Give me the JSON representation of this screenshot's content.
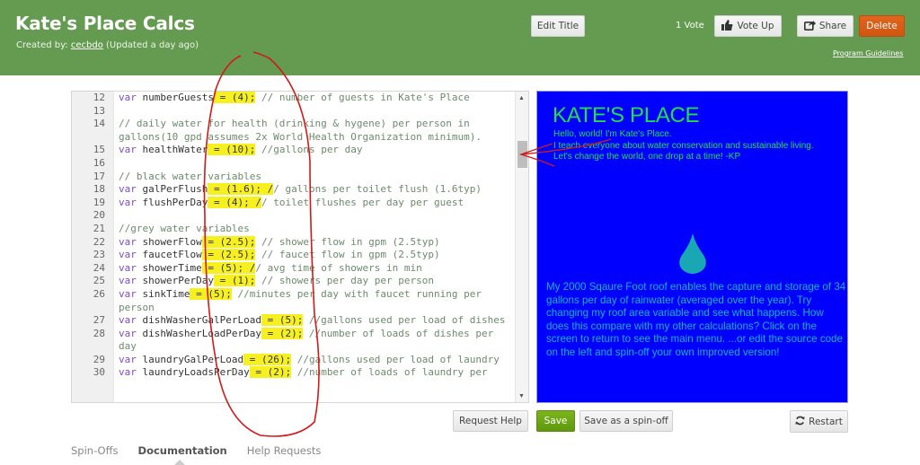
{
  "header": {
    "title": "Kate's Place Calcs",
    "created_by_label": "Created by:",
    "author": "cecbdo",
    "updated": "(Updated a day ago)",
    "edit_title_label": "Edit Title",
    "vote_count": "1 Vote",
    "vote_up_label": "Vote Up",
    "share_label": "Share",
    "delete_label": "Delete",
    "guidelines_label": "Program Guidelines"
  },
  "editor": {
    "lines": [
      {
        "n": "12",
        "kw": "var",
        "code": " numberGuests",
        "val": " = (4);",
        "comment": " // number of guests in Kate's Place"
      },
      {
        "n": "13",
        "kw": "",
        "code": "",
        "val": "",
        "comment": ""
      },
      {
        "n": "14",
        "kw": "",
        "code": "",
        "val": "",
        "comment": "// daily water for health (drinking & hygene) per person in gallons(10 gpd assumes 2x World Health Organization minimum)."
      },
      {
        "n": "15",
        "kw": "var",
        "code": " healthWater",
        "val": " = (10);",
        "comment": " //gallons per day"
      },
      {
        "n": "16",
        "kw": "",
        "code": "",
        "val": "",
        "comment": ""
      },
      {
        "n": "17",
        "kw": "",
        "code": "",
        "val": "",
        "comment": "// black water variables"
      },
      {
        "n": "18",
        "kw": "var",
        "code": " galPerFlush",
        "val": " = (1.6); /",
        "comment": "/ gallons per toilet flush (1.6typ)"
      },
      {
        "n": "19",
        "kw": "var",
        "code": " flushPerDay",
        "val": " = (4); /",
        "comment": "/ toilet flushes per day per guest"
      },
      {
        "n": "20",
        "kw": "",
        "code": "",
        "val": "",
        "comment": ""
      },
      {
        "n": "21",
        "kw": "",
        "code": "",
        "val": "",
        "comment": "//grey water variables"
      },
      {
        "n": "22",
        "kw": "var",
        "code": " showerFlow",
        "val": " = (2.5);",
        "comment": " // shower flow in gpm (2.5typ)"
      },
      {
        "n": "23",
        "kw": "var",
        "code": " faucetFlow",
        "val": " = (2.5);",
        "comment": " // faucet flow in gpm (2.5typ)"
      },
      {
        "n": "24",
        "kw": "var",
        "code": " showerTime",
        "val": " = (5); /",
        "comment": "/ avg time of showers in min"
      },
      {
        "n": "25",
        "kw": "var",
        "code": " showerPerDay",
        "val": " = (1);",
        "comment": " // showers per day per person"
      },
      {
        "n": "26",
        "kw": "var",
        "code": " sinkTime",
        "val": " = (5);",
        "comment": " //minutes per day with faucet running per person"
      },
      {
        "n": "27",
        "kw": "var",
        "code": " dishWasherGalPerLoad",
        "val": " = (5);",
        "comment": " //gallons used per load of dishes"
      },
      {
        "n": "28",
        "kw": "var",
        "code": " dishWasherLoadPerDay",
        "val": " = (2);",
        "comment": " //number of loads of dishes per day"
      },
      {
        "n": "29",
        "kw": "var",
        "code": " laundryGalPerLoad",
        "val": " = (26);",
        "comment": " //gallons used per load of laundry"
      },
      {
        "n": "30",
        "kw": "var",
        "code": " laundryLoadsPerDay",
        "val": " = (2);",
        "comment": " //number of loads of laundry per"
      }
    ]
  },
  "canvas": {
    "title": "KATE'S PLACE",
    "hello_lines": [
      "Hello, world! I'm Kate's Place.",
      "I teach everyone about water conservation and sustainable living.",
      "Let's change the world, one drop at a time! -KP"
    ],
    "body": "My 2000 Sqaure Foot roof enables the capture and storage of 34 gallons per day of rainwater (averaged over the year).  Try changing my roof area variable and see what happens. How does this compare with my other calculations? Click on the screen to return to see the main menu.  ...or edit the source code on the left and spin-off your own improved version!",
    "bg_color": "#0000ff",
    "title_color": "#22dd44",
    "body_color": "#16b4c8"
  },
  "actions": {
    "request_help_label": "Request Help",
    "save_label": "Save",
    "spinoff_label": "Save as a spin-off",
    "restart_label": "Restart"
  },
  "tabs": [
    {
      "label": "Spin-Offs",
      "active": false
    },
    {
      "label": "Documentation",
      "active": true
    },
    {
      "label": "Help Requests",
      "active": false
    }
  ],
  "colors": {
    "header_bg": "#649b50",
    "delete_btn": "#d95d18",
    "save_btn": "#6fa816",
    "highlight": "#f6f020",
    "annotation": "#d11a1a"
  }
}
